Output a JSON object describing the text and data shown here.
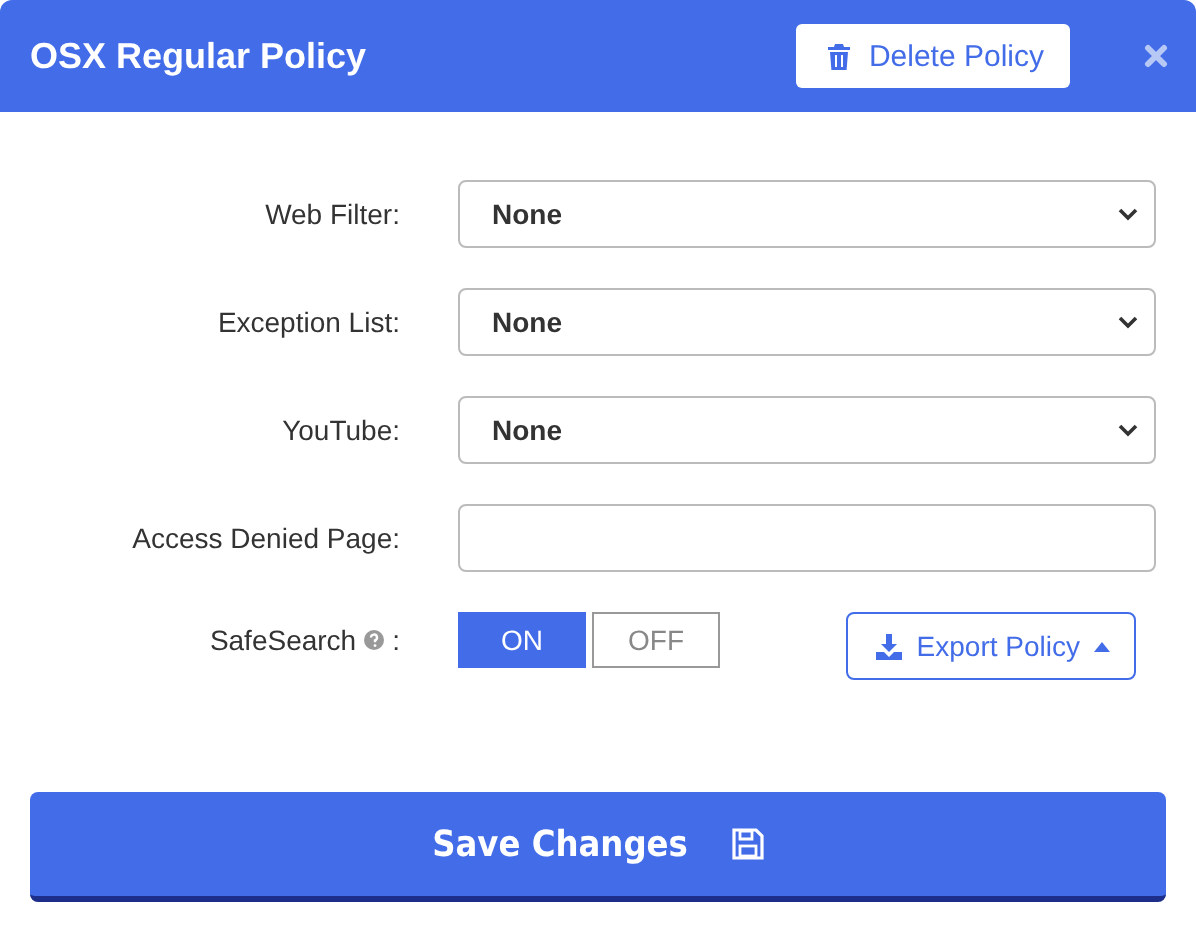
{
  "window": {
    "title": "OSX Regular Policy",
    "delete_button": "Delete Policy"
  },
  "fields": [
    {
      "label": "Web Filter:",
      "kind": "select",
      "value": "None"
    },
    {
      "label": "Exception List:",
      "kind": "select",
      "value": "None"
    },
    {
      "label": "YouTube:",
      "kind": "select",
      "value": "None"
    },
    {
      "label": "Access Denied Page:",
      "kind": "text"
    }
  ],
  "safesearch": {
    "label": "SafeSearch",
    "colon": ":",
    "options": [
      {
        "label": "ON",
        "selected": true
      },
      {
        "label": "OFF",
        "selected": false
      }
    ]
  },
  "export_button": "Export Policy",
  "save_button": "Save Changes"
}
